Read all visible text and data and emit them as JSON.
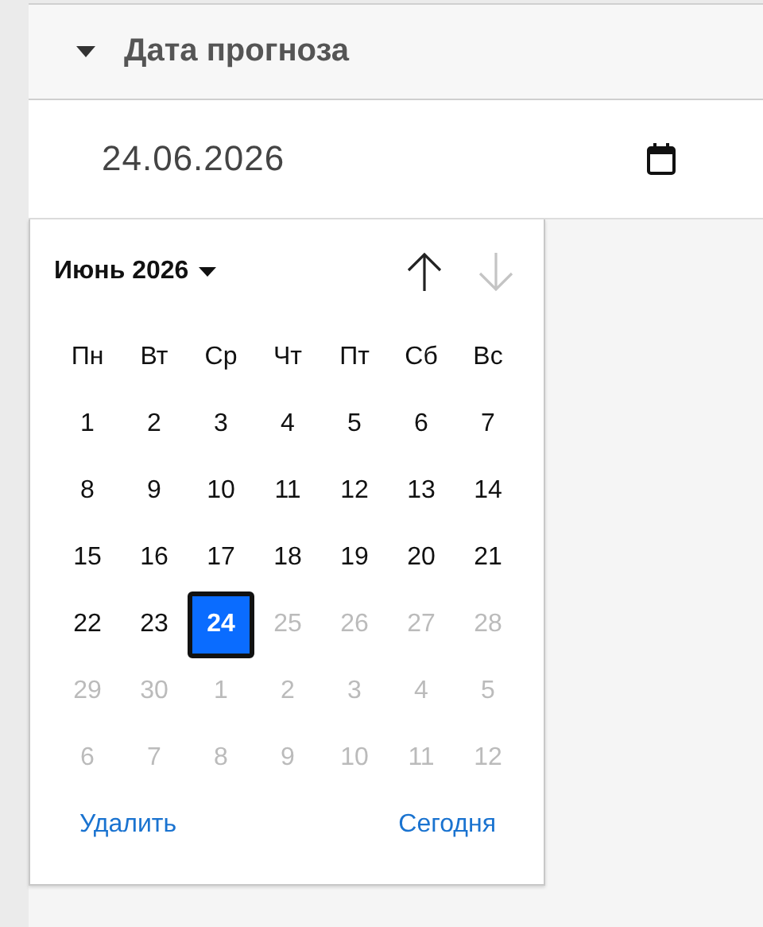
{
  "section": {
    "title": "Дата прогноза",
    "expanded": true
  },
  "date_field": {
    "value": "24.06.2026"
  },
  "calendar": {
    "month_label": "Июнь 2026",
    "nav": [
      {
        "kind": "up",
        "disabled": false
      },
      {
        "kind": "down",
        "disabled": true
      }
    ],
    "weekdays": [
      "Пн",
      "Вт",
      "Ср",
      "Чт",
      "Пт",
      "Сб",
      "Вс"
    ],
    "weeks": [
      [
        {
          "label": "1",
          "disabled": false,
          "selected": false
        },
        {
          "label": "2",
          "disabled": false,
          "selected": false
        },
        {
          "label": "3",
          "disabled": false,
          "selected": false
        },
        {
          "label": "4",
          "disabled": false,
          "selected": false
        },
        {
          "label": "5",
          "disabled": false,
          "selected": false
        },
        {
          "label": "6",
          "disabled": false,
          "selected": false
        },
        {
          "label": "7",
          "disabled": false,
          "selected": false
        }
      ],
      [
        {
          "label": "8",
          "disabled": false,
          "selected": false
        },
        {
          "label": "9",
          "disabled": false,
          "selected": false
        },
        {
          "label": "10",
          "disabled": false,
          "selected": false
        },
        {
          "label": "11",
          "disabled": false,
          "selected": false
        },
        {
          "label": "12",
          "disabled": false,
          "selected": false
        },
        {
          "label": "13",
          "disabled": false,
          "selected": false
        },
        {
          "label": "14",
          "disabled": false,
          "selected": false
        }
      ],
      [
        {
          "label": "15",
          "disabled": false,
          "selected": false
        },
        {
          "label": "16",
          "disabled": false,
          "selected": false
        },
        {
          "label": "17",
          "disabled": false,
          "selected": false
        },
        {
          "label": "18",
          "disabled": false,
          "selected": false
        },
        {
          "label": "19",
          "disabled": false,
          "selected": false
        },
        {
          "label": "20",
          "disabled": false,
          "selected": false
        },
        {
          "label": "21",
          "disabled": false,
          "selected": false
        }
      ],
      [
        {
          "label": "22",
          "disabled": false,
          "selected": false
        },
        {
          "label": "23",
          "disabled": false,
          "selected": false
        },
        {
          "label": "24",
          "disabled": false,
          "selected": true
        },
        {
          "label": "25",
          "disabled": true,
          "selected": false
        },
        {
          "label": "26",
          "disabled": true,
          "selected": false
        },
        {
          "label": "27",
          "disabled": true,
          "selected": false
        },
        {
          "label": "28",
          "disabled": true,
          "selected": false
        }
      ],
      [
        {
          "label": "29",
          "disabled": true,
          "selected": false
        },
        {
          "label": "30",
          "disabled": true,
          "selected": false
        },
        {
          "label": "1",
          "disabled": true,
          "selected": false
        },
        {
          "label": "2",
          "disabled": true,
          "selected": false
        },
        {
          "label": "3",
          "disabled": true,
          "selected": false
        },
        {
          "label": "4",
          "disabled": true,
          "selected": false
        },
        {
          "label": "5",
          "disabled": true,
          "selected": false
        }
      ],
      [
        {
          "label": "6",
          "disabled": true,
          "selected": false
        },
        {
          "label": "7",
          "disabled": true,
          "selected": false
        },
        {
          "label": "8",
          "disabled": true,
          "selected": false
        },
        {
          "label": "9",
          "disabled": true,
          "selected": false
        },
        {
          "label": "10",
          "disabled": true,
          "selected": false
        },
        {
          "label": "11",
          "disabled": true,
          "selected": false
        },
        {
          "label": "12",
          "disabled": true,
          "selected": false
        }
      ]
    ],
    "buttons": [
      "Удалить",
      "Сегодня"
    ]
  }
}
